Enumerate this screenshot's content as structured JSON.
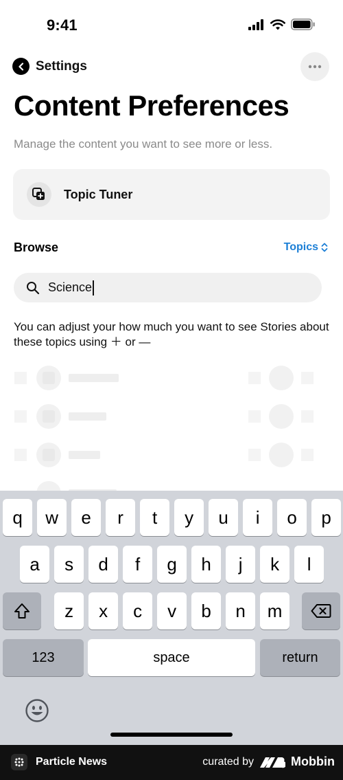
{
  "status_bar": {
    "time": "9:41"
  },
  "nav": {
    "back_label": "Settings"
  },
  "page": {
    "title": "Content Preferences",
    "subtitle": "Manage the content you want to see more or less."
  },
  "topic_tuner": {
    "label": "Topic Tuner"
  },
  "browse": {
    "label": "Browse",
    "filter_label": "Topics"
  },
  "search": {
    "value": "Science"
  },
  "helper": {
    "text": "You can adjust your how much you want to see Stories about these topics using ＋ or —"
  },
  "keyboard": {
    "row1": [
      "q",
      "w",
      "e",
      "r",
      "t",
      "y",
      "u",
      "i",
      "o",
      "p"
    ],
    "row2": [
      "a",
      "s",
      "d",
      "f",
      "g",
      "h",
      "j",
      "k",
      "l"
    ],
    "row3": [
      "z",
      "x",
      "c",
      "v",
      "b",
      "n",
      "m"
    ],
    "numbers_label": "123",
    "space_label": "space",
    "return_label": "return"
  },
  "footer": {
    "app_name": "Particle News",
    "curated_by": "curated by",
    "brand": "Mobbin"
  },
  "colors": {
    "accent": "#1c7fd6",
    "keyboard_bg": "#d1d4da",
    "footer_bg": "#111111"
  }
}
